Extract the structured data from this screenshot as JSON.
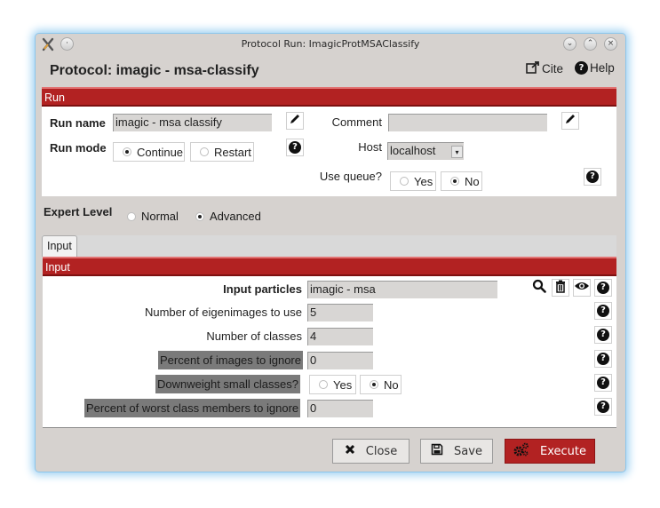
{
  "window": {
    "title": "Protocol Run: ImagicProtMSAClassify",
    "app_icon": "x-scipion-icon",
    "menu_button_icon": "dot-icon",
    "controls": [
      "minimize",
      "maximize",
      "close"
    ]
  },
  "header": {
    "title": "Protocol: imagic - msa-classify",
    "cite_label": "Cite",
    "help_label": "Help"
  },
  "run_section": {
    "header": "Run",
    "run_name_label": "Run name",
    "run_name_value": "imagic - msa classify",
    "run_mode_label": "Run mode",
    "run_mode_options": [
      {
        "label": "Continue",
        "selected": true
      },
      {
        "label": "Restart",
        "selected": false
      }
    ],
    "comment_label": "Comment",
    "comment_value": "",
    "host_label": "Host",
    "host_value": "localhost",
    "use_queue_label": "Use queue?",
    "use_queue_options": [
      {
        "label": "Yes",
        "selected": false
      },
      {
        "label": "No",
        "selected": true
      }
    ]
  },
  "expert_level": {
    "label": "Expert Level",
    "options": [
      {
        "label": "Normal",
        "selected": false
      },
      {
        "label": "Advanced",
        "selected": true
      }
    ]
  },
  "tabs": [
    {
      "label": "Input",
      "active": true
    }
  ],
  "input_section": {
    "header": "Input",
    "params": [
      {
        "label": "Input particles",
        "value": "imagic - msa",
        "bold": true,
        "highlighted": false
      },
      {
        "label": "Number of eigenimages to use",
        "value": "5",
        "bold": false,
        "highlighted": false
      },
      {
        "label": "Number of classes",
        "value": "4",
        "bold": false,
        "highlighted": false
      },
      {
        "label": "Percent of images to ignore",
        "value": "0",
        "bold": false,
        "highlighted": true
      },
      {
        "label": "Downweight small classes?",
        "options": [
          {
            "label": "Yes",
            "selected": false
          },
          {
            "label": "No",
            "selected": true
          }
        ],
        "bold": false,
        "highlighted": true
      },
      {
        "label": "Percent of worst class members to ignore",
        "value": "0",
        "bold": false,
        "highlighted": true
      }
    ]
  },
  "buttons": {
    "close": "Close",
    "save": "Save",
    "execute": "Execute"
  },
  "colors": {
    "accent": "#b22222",
    "window_bg": "#d6d2cf",
    "highlight_label_bg": "#7a7a7a"
  }
}
